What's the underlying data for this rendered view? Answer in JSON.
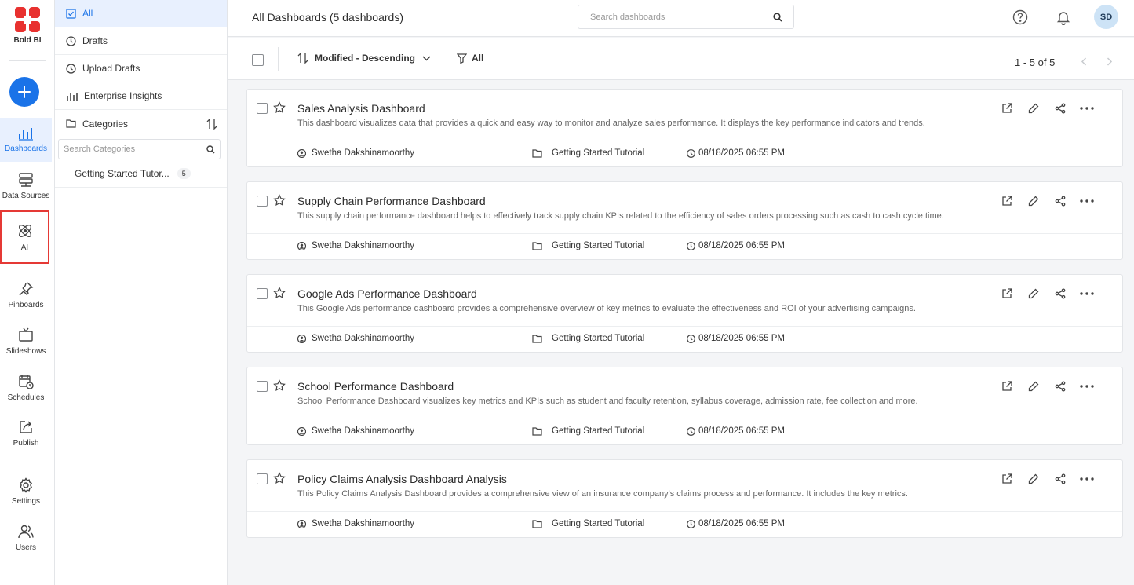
{
  "app": {
    "logo_text": "Bold BI"
  },
  "rail": {
    "items": [
      {
        "label": "Dashboards",
        "icon": "dashboards-icon"
      },
      {
        "label": "Data Sources",
        "icon": "data-sources-icon"
      },
      {
        "label": "AI",
        "icon": "ai-icon"
      },
      {
        "label": "Pinboards",
        "icon": "pin-icon"
      },
      {
        "label": "Slideshows",
        "icon": "slideshow-icon"
      },
      {
        "label": "Schedules",
        "icon": "schedule-icon"
      },
      {
        "label": "Publish",
        "icon": "publish-icon"
      },
      {
        "label": "Settings",
        "icon": "gear-icon"
      },
      {
        "label": "Users",
        "icon": "users-icon"
      }
    ]
  },
  "categories": {
    "nav": [
      {
        "label": "All"
      },
      {
        "label": "Drafts"
      },
      {
        "label": "Upload Drafts"
      },
      {
        "label": "Enterprise Insights"
      }
    ],
    "header": "Categories",
    "search_placeholder": "Search Categories",
    "entries": [
      {
        "label": "Getting Started Tutor...",
        "count": "5"
      }
    ]
  },
  "header": {
    "title": "All Dashboards (5 dashboards)",
    "search_placeholder": "Search dashboards",
    "avatar": "SD"
  },
  "toolbar": {
    "sort_label": "Modified - Descending",
    "filter_label": "All",
    "pager": "1 - 5 of 5"
  },
  "dashboards": [
    {
      "title": "Sales Analysis Dashboard",
      "description": "This dashboard visualizes data that provides a quick and easy way to monitor and analyze sales performance. It displays the key performance indicators and trends.",
      "owner": "Swetha Dakshinamoorthy",
      "category": "Getting Started Tutorial",
      "modified": "08/18/2025 06:55 PM"
    },
    {
      "title": "Supply Chain Performance Dashboard",
      "description": "This supply chain performance dashboard helps to effectively track supply chain KPIs related to the efficiency of sales orders processing such as cash to cash cycle time.",
      "owner": "Swetha Dakshinamoorthy",
      "category": "Getting Started Tutorial",
      "modified": "08/18/2025 06:55 PM"
    },
    {
      "title": "Google Ads Performance Dashboard",
      "description": "This Google Ads performance dashboard provides a comprehensive overview of key metrics to evaluate the effectiveness and ROI of your advertising campaigns.",
      "owner": "Swetha Dakshinamoorthy",
      "category": "Getting Started Tutorial",
      "modified": "08/18/2025 06:55 PM"
    },
    {
      "title": "School Performance Dashboard",
      "description": "School Performance Dashboard visualizes key metrics and KPIs such as student and faculty retention, syllabus coverage, admission rate, fee collection and more.",
      "owner": "Swetha Dakshinamoorthy",
      "category": "Getting Started Tutorial",
      "modified": "08/18/2025 06:55 PM"
    },
    {
      "title": "Policy Claims Analysis Dashboard Analysis",
      "description": "This Policy Claims Analysis Dashboard provides a comprehensive view of an insurance company's claims process and performance. It includes the key metrics.",
      "owner": "Swetha Dakshinamoorthy",
      "category": "Getting Started Tutorial",
      "modified": "08/18/2025 06:55 PM"
    }
  ],
  "colors": {
    "accent": "#1a73e8",
    "logo_red": "#e8312f",
    "highlight_border": "#e53935",
    "active_bg": "#e8f0fe"
  }
}
